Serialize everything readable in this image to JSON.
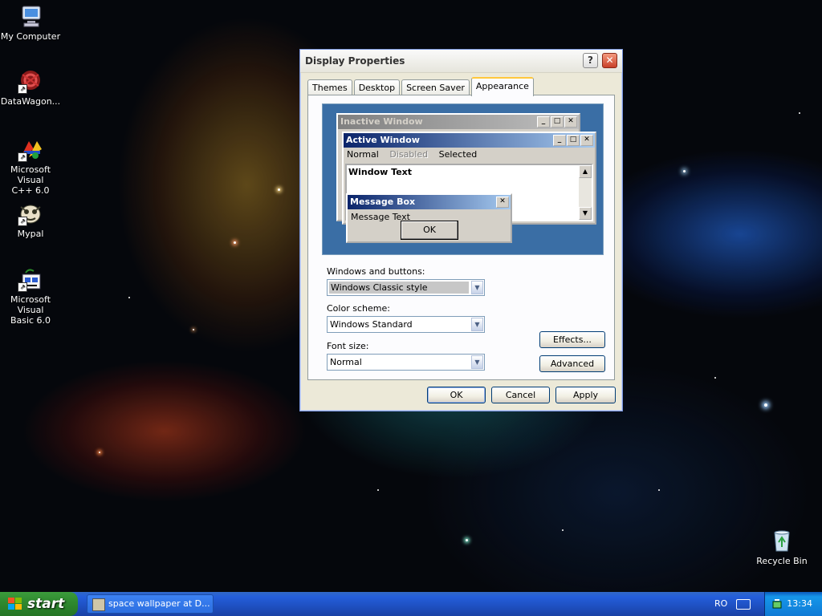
{
  "desktop": {
    "icons": [
      {
        "label_line1": "My Computer",
        "label_line2": ""
      },
      {
        "label_line1": "DataWagon...",
        "label_line2": ""
      },
      {
        "label_line1": "Microsoft Visual",
        "label_line2": "C++ 6.0"
      },
      {
        "label_line1": "Mypal",
        "label_line2": ""
      },
      {
        "label_line1": "Microsoft Visual",
        "label_line2": "Basic 6.0"
      },
      {
        "label_line1": "Recycle Bin",
        "label_line2": ""
      }
    ]
  },
  "dialog": {
    "title": "Display Properties",
    "help_glyph": "?",
    "close_glyph": "✕",
    "tabs": [
      "Themes",
      "Desktop",
      "Screen Saver",
      "Appearance"
    ],
    "active_tab": "Appearance",
    "preview": {
      "inactive_title": "Inactive Window",
      "active_title": "Active Window",
      "menu_normal": "Normal",
      "menu_disabled": "Disabled",
      "menu_selected": "Selected",
      "window_text": "Window Text",
      "msgbox_title": "Message Box",
      "msgbox_text": "Message Text",
      "msgbox_ok": "OK"
    },
    "windows_buttons": {
      "label": "Windows and buttons:",
      "value": "Windows Classic style"
    },
    "color_scheme": {
      "label": "Color scheme:",
      "value": "Windows Standard"
    },
    "font_size": {
      "label": "Font size:",
      "value": "Normal"
    },
    "effects_label": "Effects...",
    "advanced_label": "Advanced",
    "ok_label": "OK",
    "cancel_label": "Cancel",
    "apply_label": "Apply"
  },
  "taskbar": {
    "start_label": "start",
    "task_item": "space wallpaper at D...",
    "language": "RO",
    "clock": "13:34"
  },
  "colors": {
    "xp_blue": "#245edb",
    "start_green": "#2f8a2f",
    "dialog_face": "#ece9d8",
    "preview_desktop": "#3a6ea5",
    "active_caption": "#0a246a"
  }
}
